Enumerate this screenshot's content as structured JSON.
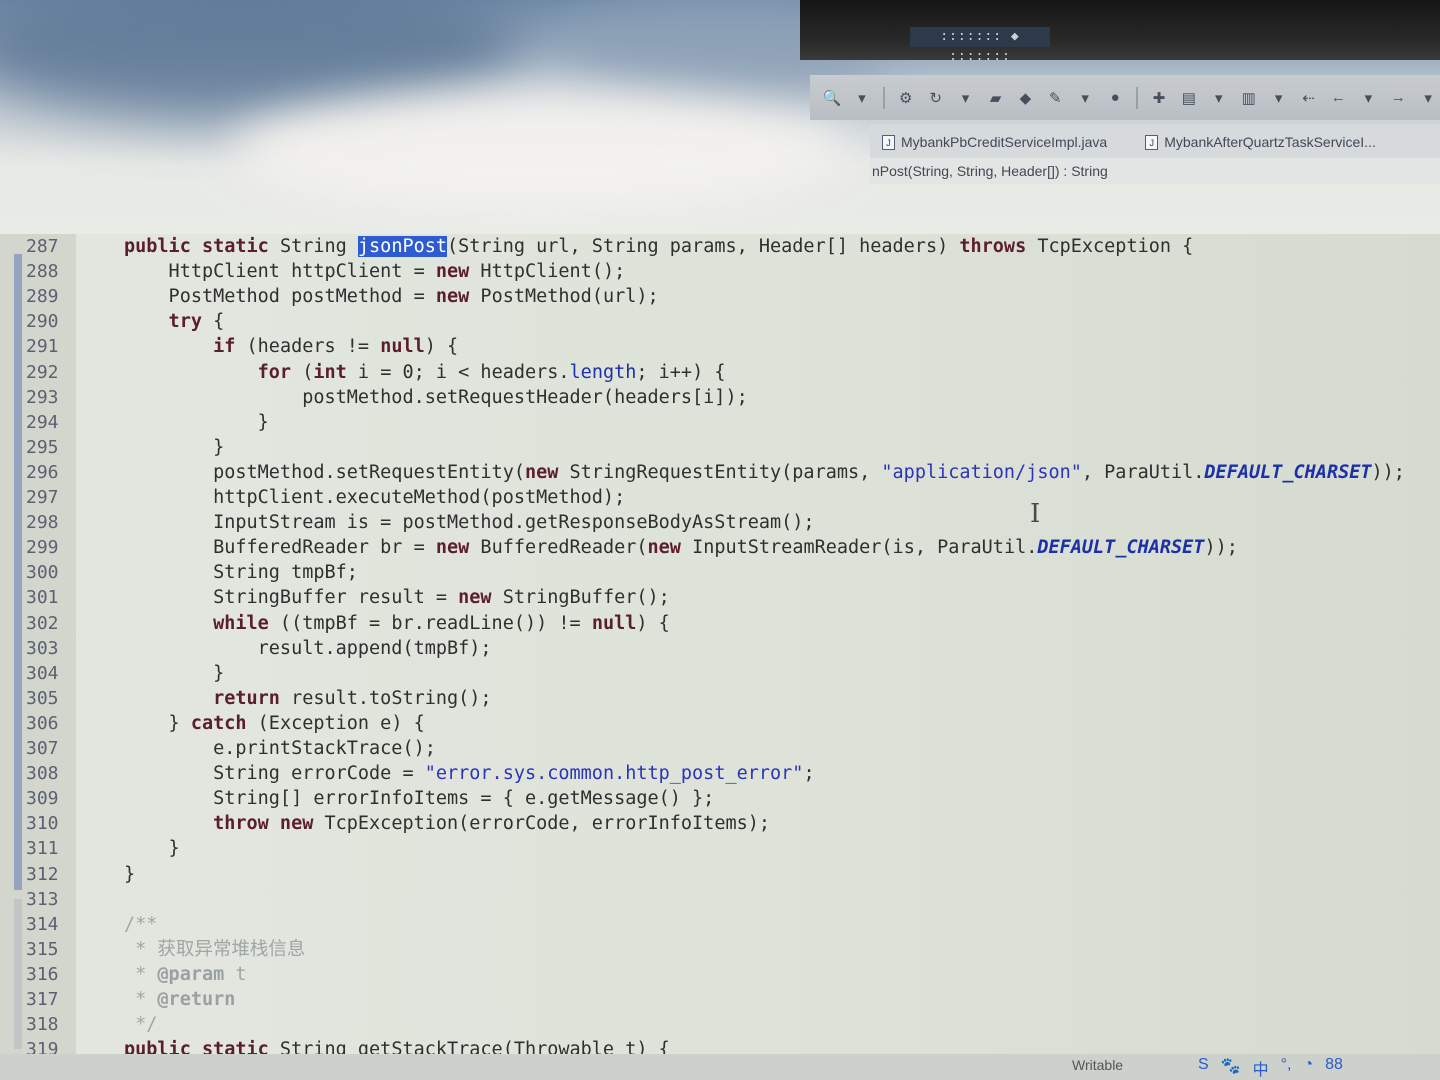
{
  "window": {
    "title_bar_text": "::::::: ◆ :::::::"
  },
  "editor_tabs": [
    {
      "label": "MybankPbCreditServiceImpl.java",
      "icon": "java-file-icon"
    },
    {
      "label": "MybankAfterQuartzTaskServiceI...",
      "icon": "java-file-icon"
    }
  ],
  "breadcrumb": "nPost(String, String, Header[]) : String",
  "code_lines": [
    {
      "num": "287",
      "tokens": [
        [
          "kw",
          "public static "
        ],
        [
          "",
          "String "
        ],
        [
          "sel",
          "jsonPost"
        ],
        [
          "",
          "(String url, String params, Header[] headers) "
        ],
        [
          "kw",
          "throws"
        ],
        [
          "",
          " TcpException {"
        ]
      ]
    },
    {
      "num": "288",
      "tokens": [
        [
          "",
          "    HttpClient httpClient = "
        ],
        [
          "kw",
          "new"
        ],
        [
          "",
          " HttpClient();"
        ]
      ]
    },
    {
      "num": "289",
      "tokens": [
        [
          "",
          "    PostMethod postMethod = "
        ],
        [
          "kw",
          "new"
        ],
        [
          "",
          " PostMethod(url);"
        ]
      ]
    },
    {
      "num": "290",
      "tokens": [
        [
          "kw",
          "    try"
        ],
        [
          "",
          " {"
        ]
      ]
    },
    {
      "num": "291",
      "tokens": [
        [
          "kw",
          "        if"
        ],
        [
          "",
          " (headers != "
        ],
        [
          "kw",
          "null"
        ],
        [
          "",
          ") {"
        ]
      ]
    },
    {
      "num": "292",
      "tokens": [
        [
          "kw",
          "            for"
        ],
        [
          "",
          " ("
        ],
        [
          "kw",
          "int"
        ],
        [
          "",
          " i = 0; i < headers."
        ],
        [
          "fld",
          "length"
        ],
        [
          "",
          "; i++) {"
        ]
      ]
    },
    {
      "num": "293",
      "tokens": [
        [
          "",
          "                postMethod.setRequestHeader(headers[i]);"
        ]
      ]
    },
    {
      "num": "294",
      "tokens": [
        [
          "",
          "            }"
        ]
      ]
    },
    {
      "num": "295",
      "tokens": [
        [
          "",
          "        }"
        ]
      ]
    },
    {
      "num": "296",
      "tokens": [
        [
          "",
          "        postMethod.setRequestEntity("
        ],
        [
          "kw",
          "new"
        ],
        [
          "",
          " StringRequestEntity(params, "
        ],
        [
          "str",
          "\"application/json\""
        ],
        [
          "",
          ", ParaUtil."
        ],
        [
          "cst",
          "DEFAULT_CHARSET"
        ],
        [
          "",
          "));"
        ]
      ]
    },
    {
      "num": "297",
      "tokens": [
        [
          "",
          "        httpClient.executeMethod(postMethod);"
        ]
      ]
    },
    {
      "num": "298",
      "tokens": [
        [
          "",
          "        InputStream is = postMethod.getResponseBodyAsStream();"
        ]
      ]
    },
    {
      "num": "299",
      "tokens": [
        [
          "",
          "        BufferedReader br = "
        ],
        [
          "kw",
          "new"
        ],
        [
          "",
          " BufferedReader("
        ],
        [
          "kw",
          "new"
        ],
        [
          "",
          " InputStreamReader(is, ParaUtil."
        ],
        [
          "cst",
          "DEFAULT_CHARSET"
        ],
        [
          "",
          "));"
        ]
      ]
    },
    {
      "num": "300",
      "tokens": [
        [
          "",
          "        String tmpBf;"
        ]
      ]
    },
    {
      "num": "301",
      "tokens": [
        [
          "",
          "        StringBuffer result = "
        ],
        [
          "kw",
          "new"
        ],
        [
          "",
          " StringBuffer();"
        ]
      ]
    },
    {
      "num": "302",
      "tokens": [
        [
          "kw",
          "        while"
        ],
        [
          "",
          " ((tmpBf = br.readLine()) != "
        ],
        [
          "kw",
          "null"
        ],
        [
          "",
          ") {"
        ]
      ]
    },
    {
      "num": "303",
      "tokens": [
        [
          "",
          "            result.append(tmpBf);"
        ]
      ]
    },
    {
      "num": "304",
      "tokens": [
        [
          "",
          "        }"
        ]
      ]
    },
    {
      "num": "305",
      "tokens": [
        [
          "kw",
          "        return"
        ],
        [
          "",
          " result.toString();"
        ]
      ]
    },
    {
      "num": "306",
      "tokens": [
        [
          "",
          "    } "
        ],
        [
          "kw",
          "catch"
        ],
        [
          "",
          " (Exception e) {"
        ]
      ]
    },
    {
      "num": "307",
      "tokens": [
        [
          "",
          "        e.printStackTrace();"
        ]
      ]
    },
    {
      "num": "308",
      "tokens": [
        [
          "",
          "        String errorCode = "
        ],
        [
          "str",
          "\"error.sys.common.http_post_error\""
        ],
        [
          "",
          ";"
        ]
      ]
    },
    {
      "num": "309",
      "tokens": [
        [
          "",
          "        String[] errorInfoItems = { e.getMessage() };"
        ]
      ]
    },
    {
      "num": "310",
      "tokens": [
        [
          "kw",
          "        throw new"
        ],
        [
          "",
          " TcpException(errorCode, errorInfoItems);"
        ]
      ]
    },
    {
      "num": "311",
      "tokens": [
        [
          "",
          "    }"
        ]
      ]
    },
    {
      "num": "312",
      "tokens": [
        [
          "",
          "}"
        ]
      ]
    },
    {
      "num": "313",
      "tokens": [
        [
          "",
          ""
        ]
      ]
    },
    {
      "num": "314",
      "tokens": [
        [
          "cmt",
          "/**"
        ]
      ]
    },
    {
      "num": "315",
      "tokens": [
        [
          "cmt",
          " * 获取异常堆栈信息"
        ]
      ]
    },
    {
      "num": "316",
      "tokens": [
        [
          "cmt",
          " * "
        ],
        [
          "cmtk",
          "@param"
        ],
        [
          "cmt",
          " t"
        ]
      ]
    },
    {
      "num": "317",
      "tokens": [
        [
          "cmt",
          " * "
        ],
        [
          "cmtk",
          "@return"
        ]
      ]
    },
    {
      "num": "318",
      "tokens": [
        [
          "cmt",
          " */"
        ]
      ]
    },
    {
      "num": "319",
      "tokens": [
        [
          "kw",
          "public static"
        ],
        [
          "",
          " String getStackTrace(Throwable t) {"
        ]
      ]
    }
  ],
  "status_bar": {
    "writable": "Writable",
    "tray_icons": [
      "S",
      "🐾",
      "中",
      "°,",
      "◔",
      "88"
    ]
  },
  "colors": {
    "keyword": "#5b1e2c",
    "string": "#2b34b8",
    "constant": "#1d30a8",
    "selection": "#2e5bd0",
    "comment": "#a0a6a6"
  }
}
